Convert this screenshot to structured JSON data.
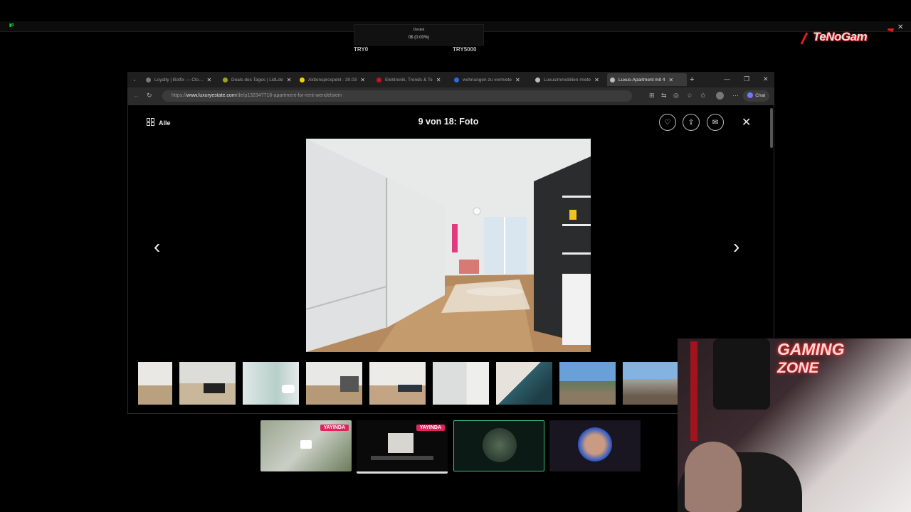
{
  "overlay": {
    "status": "▮0",
    "donation_label": "Destek",
    "donation_value": "0$ (0.00%)",
    "min_label": "TRY0",
    "max_label": "TRY5000",
    "stream_logo": "TeNoGam"
  },
  "browser": {
    "tabs": [
      {
        "title": "Loyalty | Botfix — Clo…",
        "favicon_color": "#777777",
        "active": false
      },
      {
        "title": "Deals des Tages | LidLde",
        "favicon_color": "#9aa51b",
        "active": false
      },
      {
        "title": "Aktionsprospekt - 30.03",
        "favicon_color": "#f2d200",
        "active": false
      },
      {
        "title": "Elektronik, Trends & Te",
        "favicon_color": "#c0161d",
        "active": false
      },
      {
        "title": "wohnungen zu vermiete",
        "favicon_color": "#2f6bd8",
        "active": false
      },
      {
        "title": "Luxusimmobilien miete",
        "favicon_color": "#bbbbbb",
        "active": false
      },
      {
        "title": "Luxus-Apartment mit 4",
        "favicon_color": "#bbbbbb",
        "active": true
      }
    ],
    "url_prefix": "https://",
    "url_domain": "www.luxuryestate.com",
    "url_path": "/de/p132347716-apartment-for-rent-wendelstein",
    "chat_label": "Chat"
  },
  "gallery": {
    "all_label": "Alle",
    "counter": "9 von 18: Foto"
  },
  "streams": {
    "live_label": "YAYINDA"
  },
  "webcam": {
    "sign_line1": "GAMING",
    "sign_line2": "ZONE"
  },
  "icons": [
    "grid-icon",
    "heart-icon",
    "share-icon",
    "mail-icon",
    "close-icon",
    "chevron-left-icon",
    "chevron-right-icon",
    "back-icon",
    "reload-icon",
    "star-icon",
    "more-icon"
  ]
}
